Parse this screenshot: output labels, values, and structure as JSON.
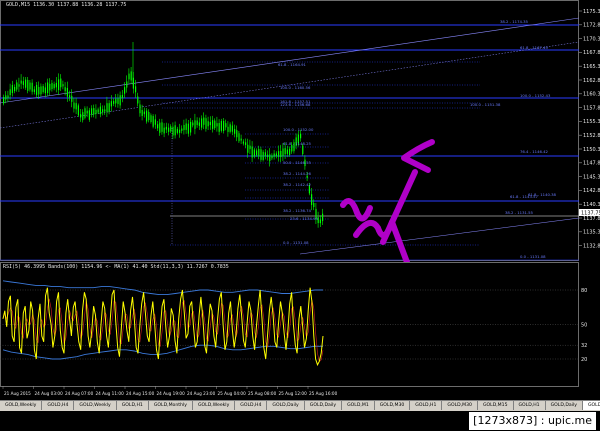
{
  "chart": {
    "title": "GOLD,M15  1136.30 1137.88 1136.28 1137.75",
    "price_labels": [
      "1175.30",
      "1172.80",
      "1170.30",
      "1167.80",
      "1165.30",
      "1162.80",
      "1160.30",
      "1157.80",
      "1155.30",
      "1152.80",
      "1150.30",
      "1147.80",
      "1145.30",
      "1142.80",
      "1140.30",
      "1137.80",
      "1135.30",
      "1132.80"
    ],
    "current_price": "1137.75",
    "fib_labels": [
      "38.2 - 1174.35",
      "61.8 - 1167.49",
      "100.0 - 1152.43",
      "61.8 - 1164.91",
      "100.0 - 1160.56",
      "161.8 - 1157.51",
      "123.6 - 1156.68",
      "100.0 - 1151.38",
      "76.4 - 1146.42",
      "61.8 - 1143.57",
      "100.0 - 1152.00",
      "61.8 - 1148.25",
      "50.0 - 1146.55",
      "38.2 - 1144.26",
      "0.0 - 1131.08",
      "38.2 - 1142.42",
      "38.2 - 1136.74",
      "23.6 - 1134.95",
      "0.0 - 1131.08",
      "61.8 - 1140.38",
      "38.2 - 1131.55"
    ]
  },
  "indicator": {
    "header": "RSI(5) 46.3995  Bands(100) 1154.96  <- MA(1) 41.40  Std(11,3,3) 11.7267  0.7835",
    "levels": [
      "80",
      "50",
      "32",
      "20"
    ],
    "levels_values": [
      80,
      50,
      32,
      20
    ],
    "rsi": [
      55,
      62,
      48,
      70,
      75,
      40,
      35,
      65,
      72,
      30,
      25,
      60,
      66,
      38,
      45,
      70,
      62,
      28,
      20,
      55,
      68,
      40,
      35,
      75,
      82,
      60,
      50,
      30,
      40,
      70,
      78,
      45,
      30,
      25,
      60,
      72,
      55,
      40,
      65,
      70,
      50,
      35,
      28,
      62,
      78,
      72,
      40,
      30,
      45,
      66,
      58,
      35,
      25,
      50,
      70,
      64,
      40,
      30,
      55,
      76,
      80,
      52,
      30,
      22,
      48,
      70,
      60,
      45,
      35,
      62,
      74,
      55,
      30,
      25,
      50,
      68,
      78,
      60,
      40,
      35,
      58,
      70,
      50,
      28,
      20,
      45,
      66,
      72,
      48,
      30,
      40,
      64,
      58,
      36,
      25,
      55,
      72,
      80,
      60,
      38,
      42,
      66,
      70,
      48,
      30,
      35,
      58,
      74,
      56,
      32,
      25,
      50,
      68,
      62,
      40,
      30,
      55,
      72,
      78,
      50,
      28,
      35,
      60,
      70,
      45,
      30,
      42,
      64,
      76,
      58,
      36,
      30,
      52,
      70,
      62,
      40,
      28,
      48,
      66,
      80,
      55,
      30,
      20,
      40,
      62,
      74,
      58,
      35,
      30,
      52,
      70,
      60,
      42,
      28,
      45,
      68,
      78,
      50,
      32,
      25,
      55,
      66,
      48,
      30,
      38,
      62,
      82,
      70,
      40,
      20,
      15,
      18,
      25,
      40
    ],
    "upper_band": [
      88,
      87,
      86,
      85,
      84,
      84,
      83,
      83,
      82,
      82,
      82,
      82,
      83,
      83,
      82,
      81,
      80,
      78,
      77,
      76,
      76,
      77,
      78,
      79,
      80,
      80,
      79,
      78,
      78,
      79,
      80,
      80,
      79,
      78,
      77,
      77,
      78,
      79,
      80,
      80
    ],
    "lower_band": [
      28,
      26,
      25,
      24,
      22,
      21,
      20,
      20,
      21,
      22,
      24,
      25,
      26,
      27,
      28,
      28,
      27,
      25,
      24,
      24,
      25,
      27,
      29,
      31,
      32,
      32,
      31,
      29,
      28,
      28,
      29,
      30,
      31,
      31,
      30,
      29,
      29,
      30,
      31,
      31
    ]
  },
  "time_labels": [
    "21 Aug 2015",
    "24 Aug 03:00",
    "24 Aug 07:00",
    "24 Aug 11:00",
    "24 Aug 15:00",
    "24 Aug 19:00",
    "24 Aug 23:00",
    "25 Aug 04:00",
    "25 Aug 08:00",
    "25 Aug 12:00",
    "25 Aug 16:00"
  ],
  "tabs": [
    {
      "label": "GOLD,Weekly",
      "active": false
    },
    {
      "label": "GOLD,H4",
      "active": false
    },
    {
      "label": "GOLD,Weekly",
      "active": false
    },
    {
      "label": "GOLD,H1",
      "active": false
    },
    {
      "label": "GOLD,Monthly",
      "active": false
    },
    {
      "label": "GOLD,Weekly",
      "active": false
    },
    {
      "label": "GOLD,H4",
      "active": false
    },
    {
      "label": "GOLD,Daily",
      "active": false
    },
    {
      "label": "GOLD,Daily",
      "active": false
    },
    {
      "label": "GOLD,M1",
      "active": false
    },
    {
      "label": "GOLD,M30",
      "active": false
    },
    {
      "label": "GOLD,H1",
      "active": false
    },
    {
      "label": "GOLD,M30",
      "active": false
    },
    {
      "label": "GOLD,M15",
      "active": false
    },
    {
      "label": "GOLD,H1",
      "active": false
    },
    {
      "label": "GOLD,Daily",
      "active": false
    },
    {
      "label": "GOLD,Daily",
      "active": true
    }
  ],
  "watermark": "[1273x873]",
  "site": "upic.me",
  "stamp_sep": " : ",
  "colors": {
    "bull": "#00ff00",
    "level": "#2a3cff",
    "annot": "#b000c8",
    "rsi": "#ffff00",
    "band": "#3a78d8"
  }
}
